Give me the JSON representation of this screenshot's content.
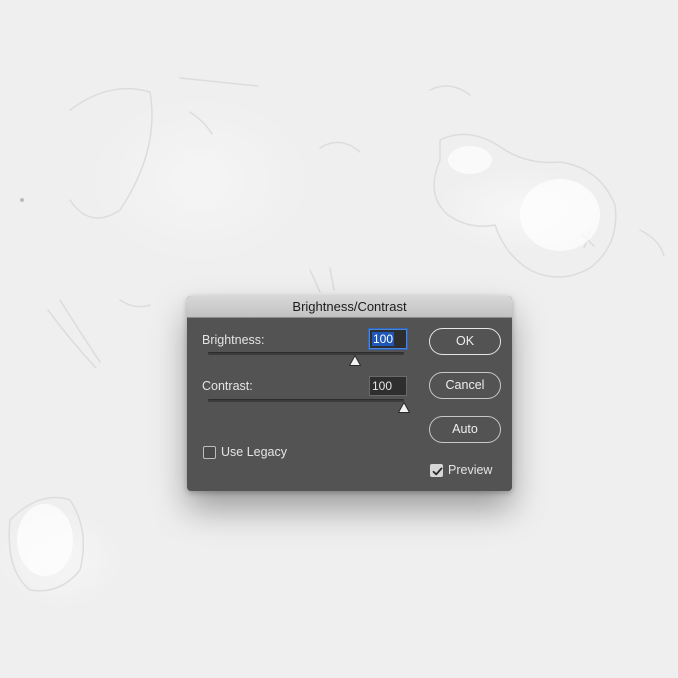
{
  "dialog": {
    "title": "Brightness/Contrast",
    "brightness": {
      "label": "Brightness:",
      "value": "100",
      "slider_fraction": 0.75
    },
    "contrast": {
      "label": "Contrast:",
      "value": "100",
      "slider_fraction": 1.0
    },
    "use_legacy": {
      "label": "Use Legacy",
      "checked": false
    },
    "preview": {
      "label": "Preview",
      "checked": true
    },
    "buttons": {
      "ok": "OK",
      "cancel": "Cancel",
      "auto": "Auto"
    }
  },
  "icons": {
    "slider_thumb": "triangle-thumb-icon",
    "checkmark": "checkmark-icon"
  },
  "colors": {
    "dialog_bg": "#535353",
    "titlebar": "#c9c9c9",
    "focus_ring": "#4d84d6",
    "selection": "#1f57b8"
  }
}
